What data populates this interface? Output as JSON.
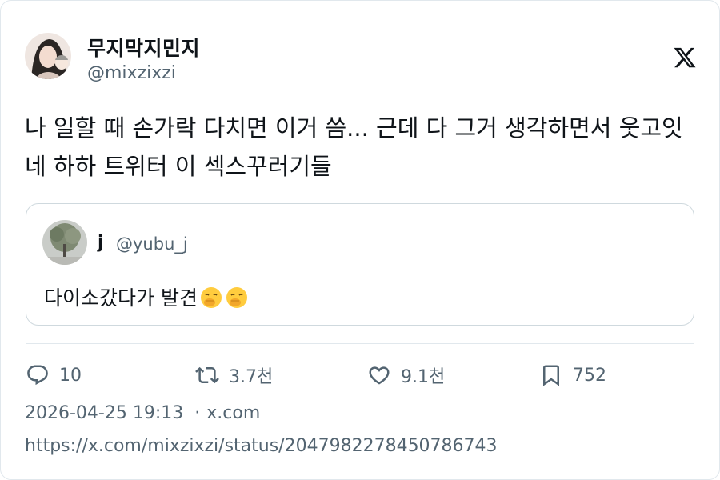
{
  "author": {
    "display_name": "무지막지민지",
    "handle": "@mixzixzi"
  },
  "tweet": {
    "text": "나 일할 때 손가락 다치면 이거 씀... 근데 다 그거 생각하면서 웃고잇네 하하 트위터 이 섹스꾸러기들"
  },
  "quote": {
    "display_name": "j",
    "handle": "@yubu_j",
    "text": "다이소갔다가 발견",
    "emoji_icons": [
      "hand-over-mouth-emoji",
      "hand-over-mouth-emoji"
    ]
  },
  "actions": {
    "reply_count": "10",
    "retweet_count": "3.7천",
    "like_count": "9.1천",
    "bookmark_count": "752"
  },
  "meta": {
    "timestamp": "2026-04-25 19:13",
    "separator": "·",
    "source": "x.com"
  },
  "url": "https://x.com/mixzixzi/status/2047982278450786743",
  "colors": {
    "text": "#0f1419",
    "secondary": "#536471",
    "border": "#cfd9de"
  }
}
